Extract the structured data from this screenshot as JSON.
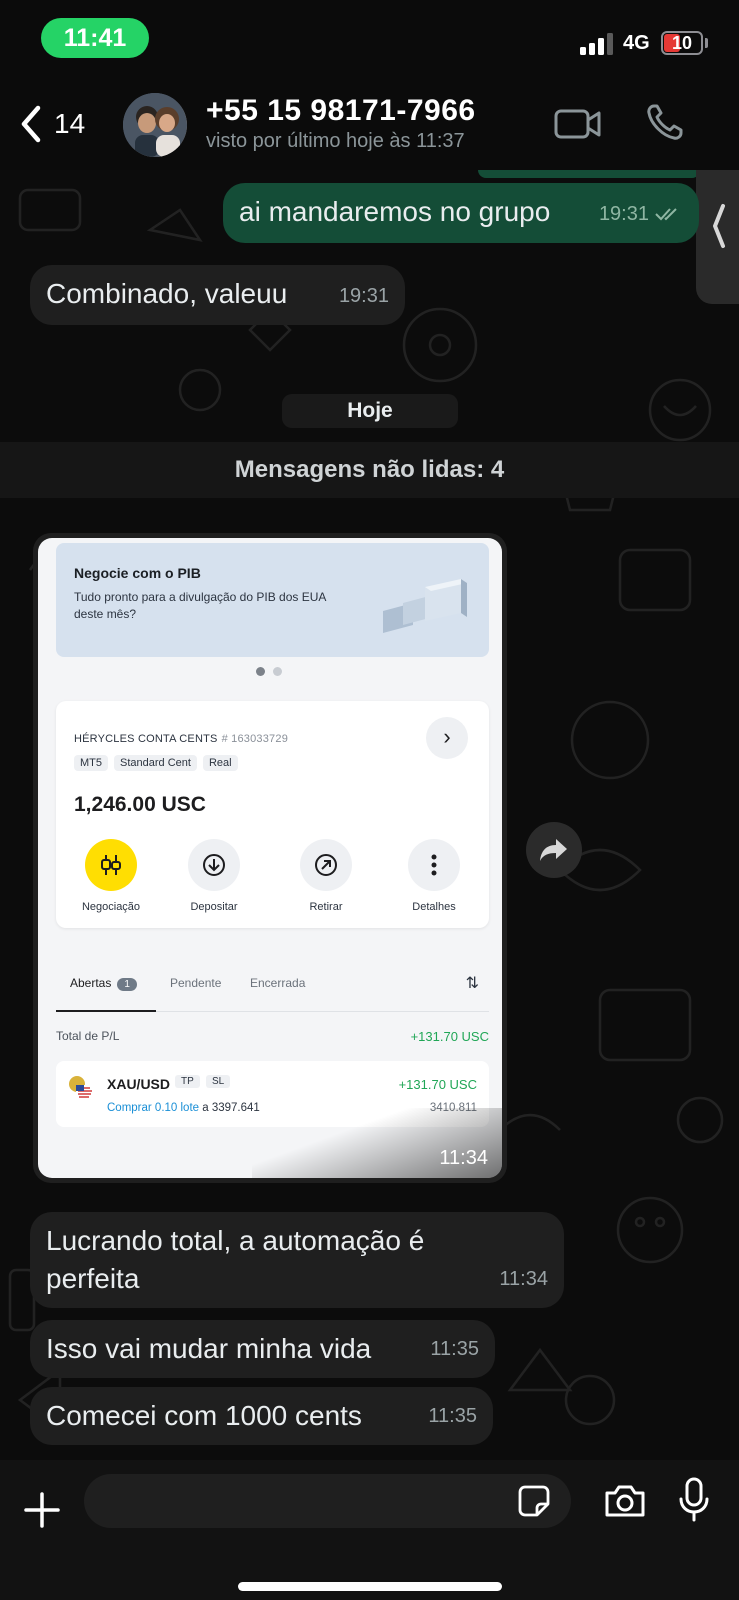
{
  "status_bar": {
    "time": "11:41",
    "network": "4G",
    "battery": "10",
    "battery_level": 0.1,
    "signal_bars": 3,
    "colors": {
      "time_pill": "#25d366",
      "battery_low": "#e53935"
    }
  },
  "header": {
    "back_count": "14",
    "contact_name": "+55 15 98171-7966",
    "contact_status": "visto por último hoje às 11:37",
    "icons": {
      "back": "chevron-left-icon",
      "video": "video-call-icon",
      "call": "phone-icon"
    }
  },
  "messages": {
    "sent_1": {
      "text": "ai mandaremos no grupo",
      "time": "19:31",
      "status_icon": "double-check-icon"
    },
    "recv_1": {
      "text": "Combinado, valeuu",
      "time": "19:31"
    },
    "date_separator": "Hoje",
    "unread_banner": "Mensagens não lidas: 4",
    "image_msg": {
      "time": "11:34"
    },
    "recv_2": {
      "text": "Lucrando total, a automação é perfeita",
      "time": "11:34"
    },
    "recv_3": {
      "text": "Isso vai mudar minha vida",
      "time": "11:35"
    },
    "recv_4": {
      "text": "Comecei com 1000 cents",
      "time": "11:35"
    }
  },
  "screenshot": {
    "promo": {
      "title": "Negocie com o PIB",
      "text": "Tudo pronto para a divulgação do PIB dos EUA deste mês?"
    },
    "account": {
      "name": "HÉRYCLES CONTA CENTS",
      "number": "# 163033729",
      "tags": [
        "MT5",
        "Standard Cent",
        "Real"
      ],
      "balance": "1,246.00 USC",
      "actions": {
        "trade": "Negociação",
        "deposit": "Depositar",
        "withdraw": "Retirar",
        "details": "Detalhes"
      }
    },
    "tabs": {
      "open": "Abertas",
      "open_count": "1",
      "pending": "Pendente",
      "closed": "Encerrada"
    },
    "pl": {
      "label": "Total de P/L",
      "value": "+131.70 USC"
    },
    "position": {
      "symbol": "XAU/USD",
      "tag_tp": "TP",
      "tag_sl": "SL",
      "profit": "+131.70 USC",
      "action": "Comprar 0.10 lote",
      "at": "a 3397.641",
      "current_price": "3410.811"
    },
    "colors": {
      "brand_yellow": "#ffde02",
      "profit_green": "#20a656",
      "link_blue": "#1a8fd6"
    }
  },
  "composer": {
    "placeholder": "",
    "icons": {
      "plus": "plus-icon",
      "sticker": "sticker-icon",
      "camera": "camera-icon",
      "mic": "microphone-icon"
    }
  },
  "theme": {
    "bubble_out": "#144d37",
    "bubble_in": "#1f1f1f",
    "background": "#0c0c0c"
  }
}
